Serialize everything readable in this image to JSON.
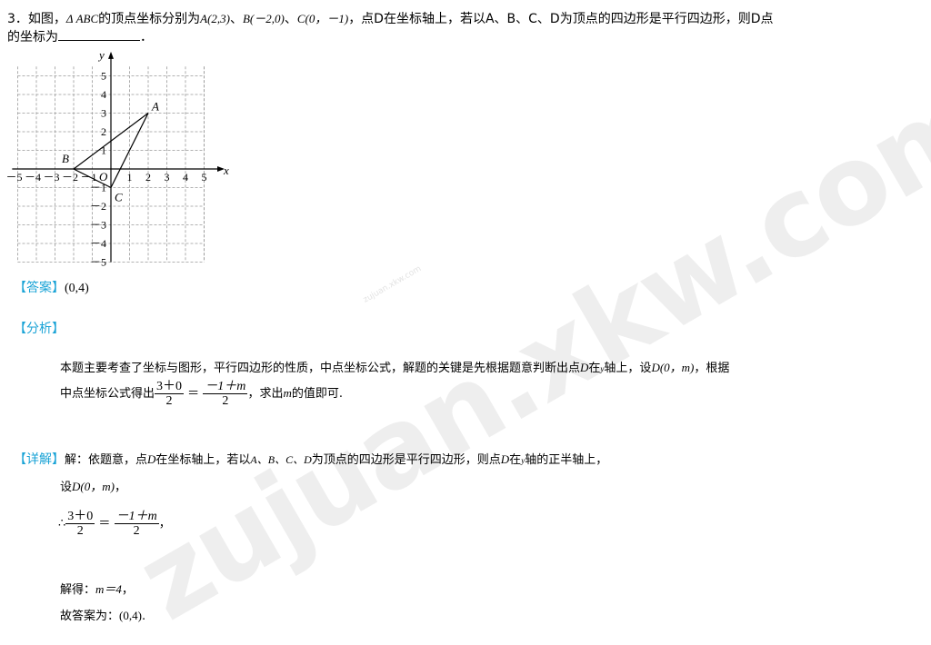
{
  "question": {
    "number": "3",
    "line1_a": "．如图，",
    "tri": "Δ ABC",
    "line1_b": "的顶点坐标分别为",
    "ptA": "A(2,3)",
    "sep1": "、",
    "ptB": "B(－2,0)",
    "sep2": "、",
    "ptC": "C(0，－1)",
    "line1_c": "，点D在坐标轴上，若以A、B、C、D为顶点的四边形是平行四边形，则D点",
    "line2": "的坐标为",
    "line2_end": "．"
  },
  "figure": {
    "axis_x": "x",
    "axis_y": "y",
    "origin": "O",
    "label_A": "A",
    "label_B": "B",
    "label_C": "C",
    "x_ticks": [
      "－5",
      "－4",
      "－3",
      "－2",
      "－1",
      "1",
      "2",
      "3",
      "4",
      "5"
    ],
    "y_ticks": [
      "5",
      "4",
      "3",
      "2",
      "1",
      "－1",
      "－2",
      "－3",
      "－4",
      "－5"
    ],
    "points": {
      "A": [
        2,
        3
      ],
      "B": [
        -2,
        0
      ],
      "C": [
        0,
        -1
      ]
    }
  },
  "answer": {
    "tag": "【答案】",
    "value": "(0,4)"
  },
  "analysis": {
    "tag": "【分析】",
    "l1_a": "本题主要考查了坐标与图形，平行四边形的性质，中点坐标公式，解题的关键是先根据题意判断出点",
    "l1_D": "D",
    "l1_b": "在",
    "l1_y": "y",
    "l1_c": "轴上，设",
    "l1_pt": "D(0，m)",
    "l1_d": "，根据",
    "l2_a": "中点坐标公式得出",
    "f1_num": "3＋0",
    "f1_den": "2",
    "eq": "＝",
    "f2_num": "－1＋m",
    "f2_den": "2",
    "l2_b": "，求出",
    "l2_m": "m",
    "l2_c": "的值即可."
  },
  "detail": {
    "tag": "【详解】",
    "l1_a": "解：依题意，点",
    "l1_D": "D",
    "l1_b": "在坐标轴上，若以",
    "l1_pts": "A、B、C、D",
    "l1_c": "为顶点的四边形是平行四边形，则点",
    "l1_D2": "D",
    "l1_d": "在",
    "l1_y": "y",
    "l1_e": "轴的正半轴上，",
    "l2_a": "设",
    "l2_pt": "D(0，m)",
    "l2_b": "，",
    "l3_therefore": "∴",
    "f1_num": "3＋0",
    "f1_den": "2",
    "eq": "＝",
    "f2_num": "－1＋m",
    "f2_den": "2",
    "l3_end": "，",
    "l4_a": "解得：",
    "l4_eq": "m＝4",
    "l4_end": "，",
    "l5_a": "故答案为：",
    "l5_val": "(0,4)",
    "l5_end": "."
  },
  "watermark": {
    "big": "zujuan.xkw.com",
    "small": "zujuan.xkw.com"
  }
}
